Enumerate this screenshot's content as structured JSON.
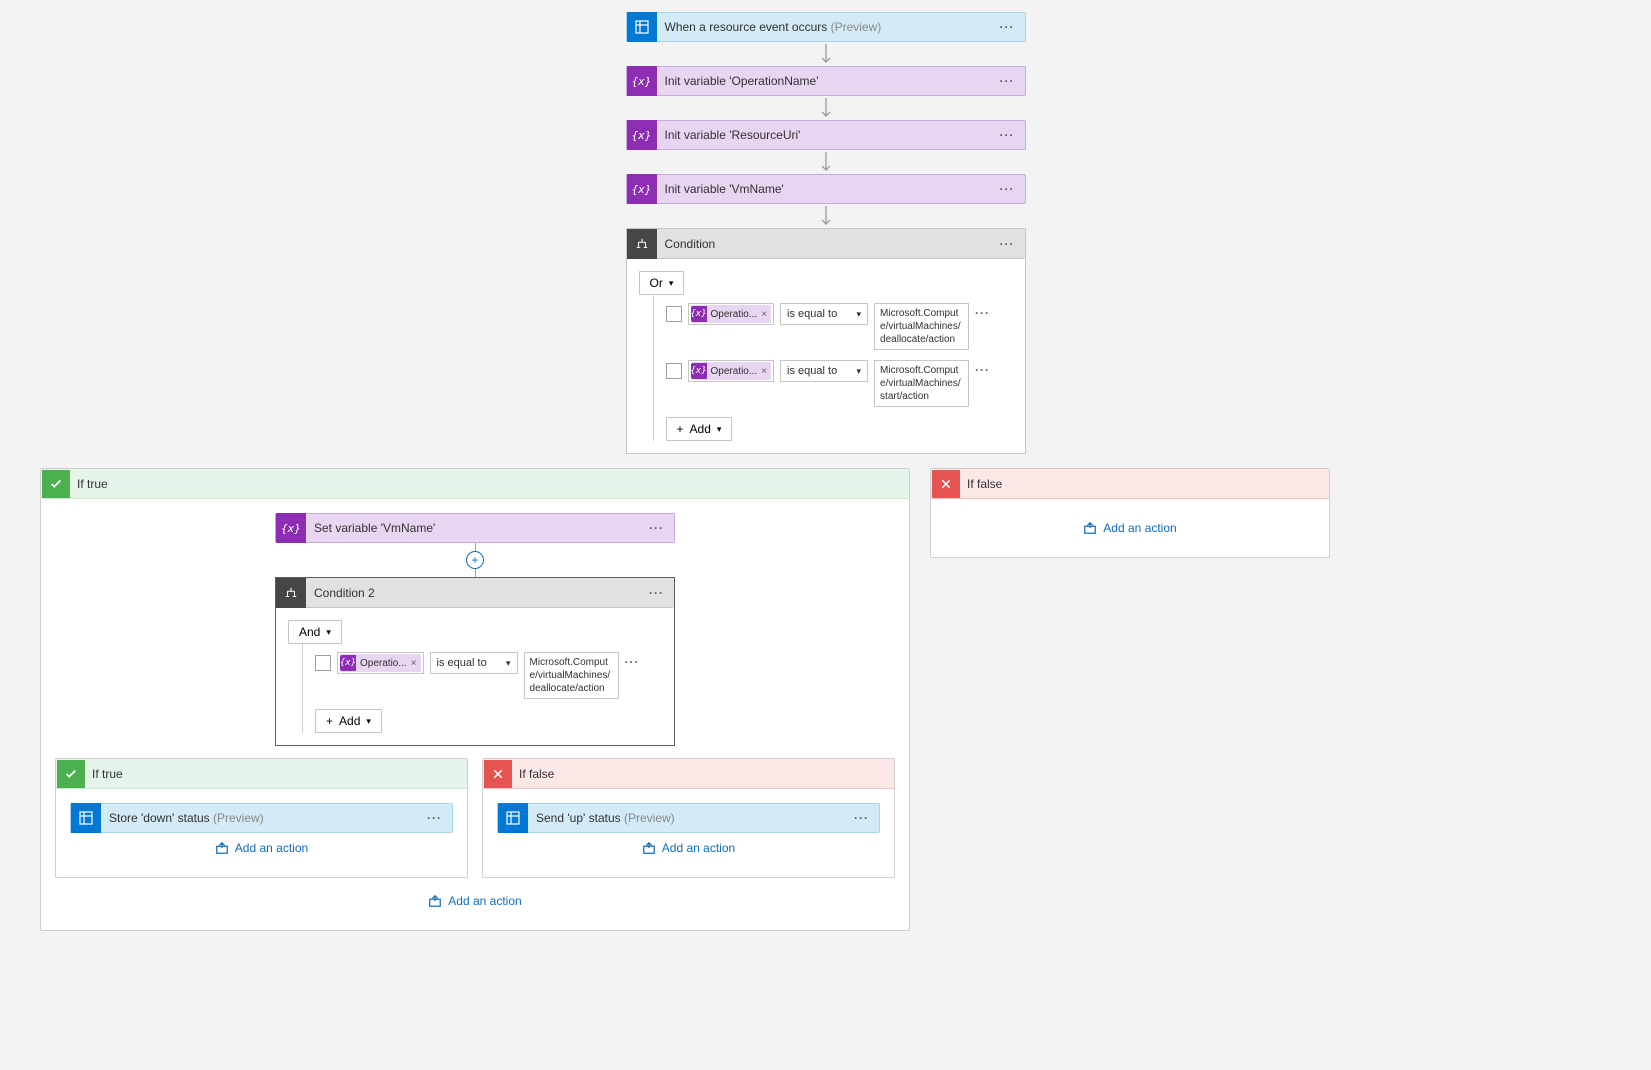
{
  "steps": {
    "trigger": {
      "title": "When a resource event occurs",
      "preview": "(Preview)"
    },
    "var1": {
      "title": "Init variable 'OperationName'"
    },
    "var2": {
      "title": "Init variable 'ResourceUri'"
    },
    "var3": {
      "title": "Init variable 'VmName'"
    },
    "condition1": {
      "title": "Condition",
      "operator": "Or",
      "addLabel": "Add",
      "rows": [
        {
          "token": "Operatio...",
          "comparator": "is equal to",
          "value": "Microsoft.Compute/virtualMachines/deallocate/action"
        },
        {
          "token": "Operatio...",
          "comparator": "is equal to",
          "value": "Microsoft.Compute/virtualMachines/start/action"
        }
      ]
    },
    "ifTrue1": {
      "label": "If true",
      "setVar": {
        "title": "Set variable 'VmName'"
      },
      "condition2": {
        "title": "Condition 2",
        "operator": "And",
        "addLabel": "Add",
        "rows": [
          {
            "token": "Operatio...",
            "comparator": "is equal to",
            "value": "Microsoft.Compute/virtualMachines/deallocate/action"
          }
        ]
      },
      "ifTrue2": {
        "label": "If true",
        "action": {
          "title": "Store 'down' status",
          "preview": "(Preview)"
        }
      },
      "ifFalse2": {
        "label": "If false",
        "action": {
          "title": "Send 'up' status",
          "preview": "(Preview)"
        }
      }
    },
    "ifFalse1": {
      "label": "If false"
    },
    "addAction": "Add an action"
  }
}
